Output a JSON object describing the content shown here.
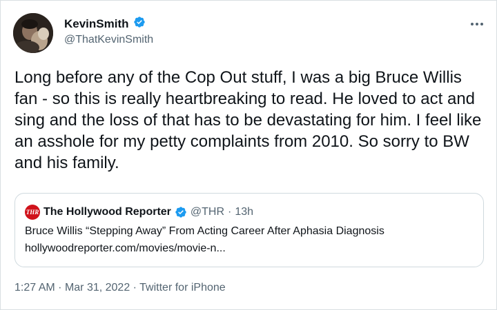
{
  "author": {
    "display_name": "KevinSmith",
    "handle": "@ThatKevinSmith",
    "verified_icon": "verified-badge-icon",
    "avatar_icon": "avatar"
  },
  "more_icon": "more-options-icon",
  "tweet": {
    "text": "Long before any of the Cop Out stuff, I was a big Bruce Willis fan - so this is really heartbreaking to read. He loved to act and sing and the loss of that has to be devastating for him. I feel like an asshole for my petty complaints from 2010. So sorry to BW and his family."
  },
  "quoted_tweet": {
    "logo_text": "THR",
    "display_name": "The Hollywood Reporter",
    "handle": "@THR",
    "separator": "·",
    "time_ago": "13h",
    "title": "Bruce Willis “Stepping Away” From Acting Career After Aphasia Diagnosis",
    "url": "hollywoodreporter.com/movies/movie-n..."
  },
  "meta": {
    "time": "1:27 AM",
    "sep1": "·",
    "date": "Mar 31, 2022",
    "sep2": "·",
    "source": "Twitter for iPhone"
  },
  "colors": {
    "verified": "#1d9bf0",
    "thr_red": "#d0121b",
    "secondary_text": "#536471",
    "primary_text": "#0f1419"
  }
}
